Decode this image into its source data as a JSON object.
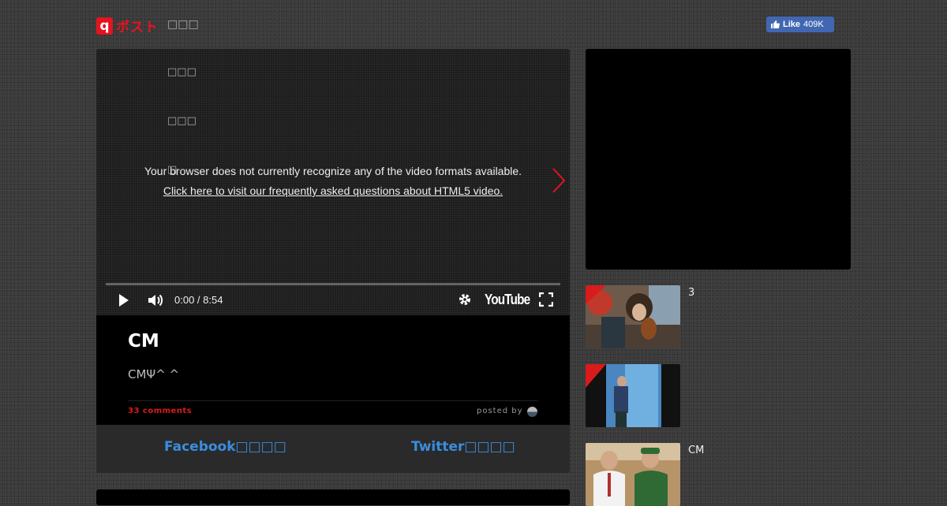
{
  "header": {
    "logo_mark": "q",
    "logo_text": "ポスト",
    "site_subtitle": "□□□",
    "like_label": "Like",
    "like_count": "409K"
  },
  "video": {
    "ghost_lines": [
      "□□□",
      "□□□",
      "□"
    ],
    "message": "Your browser does not currently recognize any of the video formats available.",
    "link_text": "Click here to visit our frequently asked questions about HTML5 video.",
    "time": "0:00 / 8:54",
    "brand": "YouTube",
    "progress": 0
  },
  "post": {
    "title": "CM",
    "description": "CMΨ^ ^",
    "comments": "33 comments",
    "posted_by": "posted by"
  },
  "share": {
    "facebook": "Facebook□□□□",
    "twitter": "Twitter□□□□"
  },
  "sidebar": {
    "items": [
      {
        "title": "3"
      },
      {
        "title": ""
      },
      {
        "title": "CM"
      }
    ]
  },
  "colors": {
    "brand_red": "#e4141e",
    "share_blue": "#3b8de0",
    "facebook_blue": "#4267b2"
  }
}
